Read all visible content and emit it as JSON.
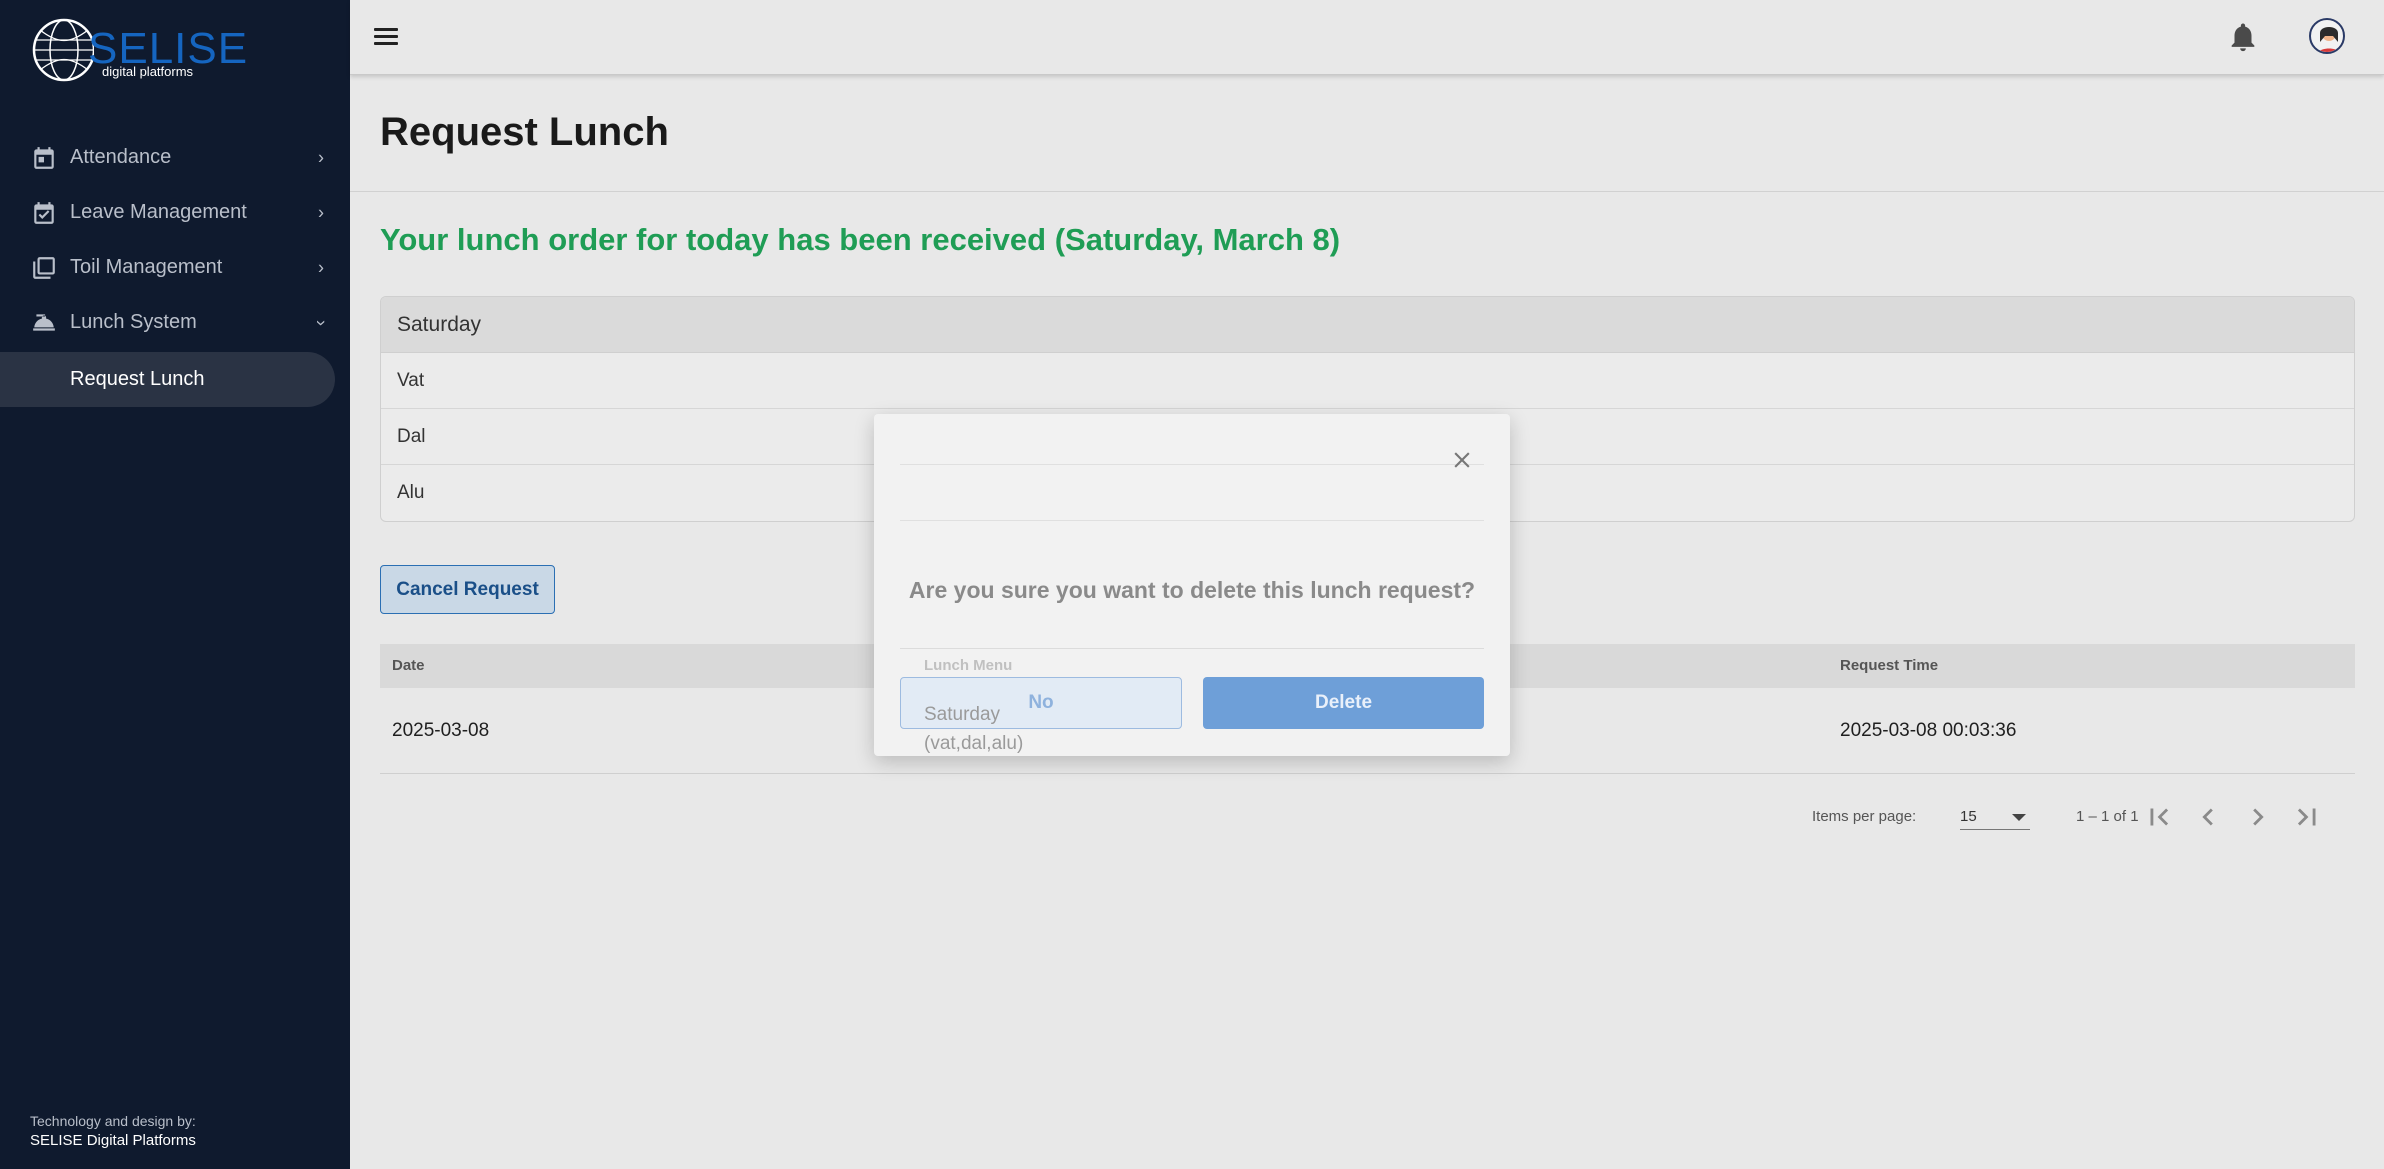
{
  "brand": {
    "name": "SELISE",
    "tagline": "digital platforms"
  },
  "sidebar": {
    "items": [
      {
        "label": "Attendance",
        "icon": "calendar-icon"
      },
      {
        "label": "Leave Management",
        "icon": "calendar-check-icon"
      },
      {
        "label": "Toil Management",
        "icon": "library-icon"
      },
      {
        "label": "Lunch System",
        "icon": "room-service-icon"
      }
    ],
    "subitem": {
      "label": "Request Lunch"
    },
    "credit_line1": "Technology and design by:",
    "credit_line2": "SELISE Digital Platforms"
  },
  "page": {
    "title": "Request Lunch",
    "success_message": "Your lunch order for today has been received (Saturday, March 8)"
  },
  "menu": {
    "day": "Saturday",
    "items": [
      "Vat",
      "Dal",
      "Alu"
    ]
  },
  "actions": {
    "cancel_label": "Cancel Request"
  },
  "table": {
    "headers": {
      "date": "Date",
      "menu": "Lunch Menu",
      "time": "Request Time"
    },
    "rows": [
      {
        "date": "2025-03-08",
        "menu_day": "Saturday",
        "menu_items": "(vat,dal,alu)",
        "time": "2025-03-08 00:03:36"
      }
    ]
  },
  "pagination": {
    "items_per_page_label": "Items per page:",
    "items_per_page": "15",
    "range": "1 – 1 of 1"
  },
  "dialog": {
    "message": "Are you sure you want to delete this lunch request?",
    "no_label": "No",
    "delete_label": "Delete"
  },
  "colors": {
    "sidebar_bg": "#0f1a2e",
    "success": "#1f9d55",
    "primary": "#2b6fb3"
  }
}
